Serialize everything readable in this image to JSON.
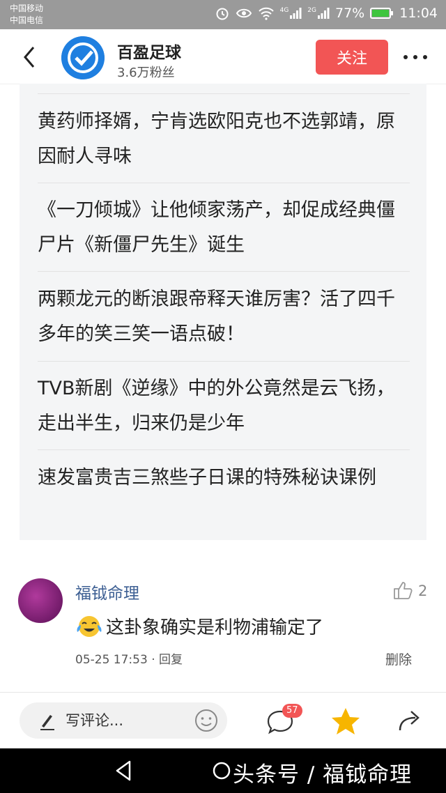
{
  "statusbar": {
    "carrier1": "中国移动",
    "carrier2": "中国电信",
    "signal1_label": "4G",
    "signal2_label": "2G",
    "battery": "77%",
    "time": "11:04"
  },
  "header": {
    "account_name": "百盈足球",
    "fans": "3.6万粉丝",
    "follow_label": "关注"
  },
  "articles": [
    "黄药师择婿，宁肯选欧阳克也不选郭靖，原因耐人寻味",
    "《一刀倾城》让他倾家荡产，却促成经典僵尸片《新僵尸先生》诞生",
    "两颗龙元的断浪跟帝释天谁厉害？活了四千多年的笑三笑一语点破！",
    "TVB新剧《逆缘》中的外公竟然是云飞扬，走出半生，归来仍是少年",
    "速发富贵吉三煞些子日课的特殊秘诀课例"
  ],
  "comment": {
    "username": "福钺命理",
    "like_count": "2",
    "text": "这卦象确实是利物浦输定了",
    "meta": "05-25 17:53 · 回复",
    "delete_label": "删除"
  },
  "bottombar": {
    "comment_placeholder": "写评论...",
    "comment_count_badge": "57"
  },
  "navbar": {
    "watermark": "头条号 / 福钺命理"
  },
  "colors": {
    "accent_red": "#f25555",
    "link_blue": "#3d5f93",
    "star_yellow": "#f7b500",
    "logo_blue": "#1f7fe0"
  }
}
